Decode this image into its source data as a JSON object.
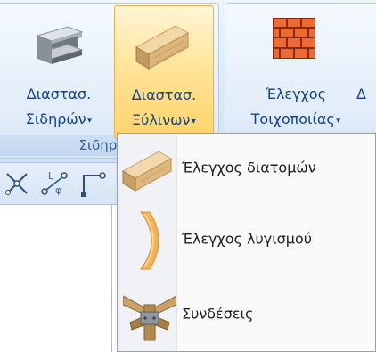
{
  "ribbon": {
    "groups": [
      {
        "label": "Σιδηρά -"
      }
    ],
    "buttons": {
      "steel": {
        "line1": "Διαστασ.",
        "line2": "Σιδηρών"
      },
      "wood": {
        "line1": "Διαστασ.",
        "line2": "Ξύλινων"
      },
      "wall": {
        "line1": "Έλεγχος",
        "line2": "Τοιχοποιίας"
      },
      "next": {
        "line1": "Δ"
      }
    },
    "dropdown_arrow": "▾"
  },
  "menu": {
    "items": [
      {
        "label": "Έλεγχος διατομών",
        "icon": "wood-beam-icon"
      },
      {
        "label": "Έλεγχος λυγισμού",
        "icon": "curved-beam-icon"
      },
      {
        "label": "Συνδέσεις",
        "icon": "timber-joint-icon"
      }
    ]
  },
  "toolstrip": {
    "icons": [
      "node-cross-icon",
      "l-phi-chain-icon",
      "hook-link-icon"
    ]
  },
  "colors": {
    "accent_text": "#15428b",
    "selected_bg": "#ffd36a",
    "wall_orange": "#e8602c"
  }
}
